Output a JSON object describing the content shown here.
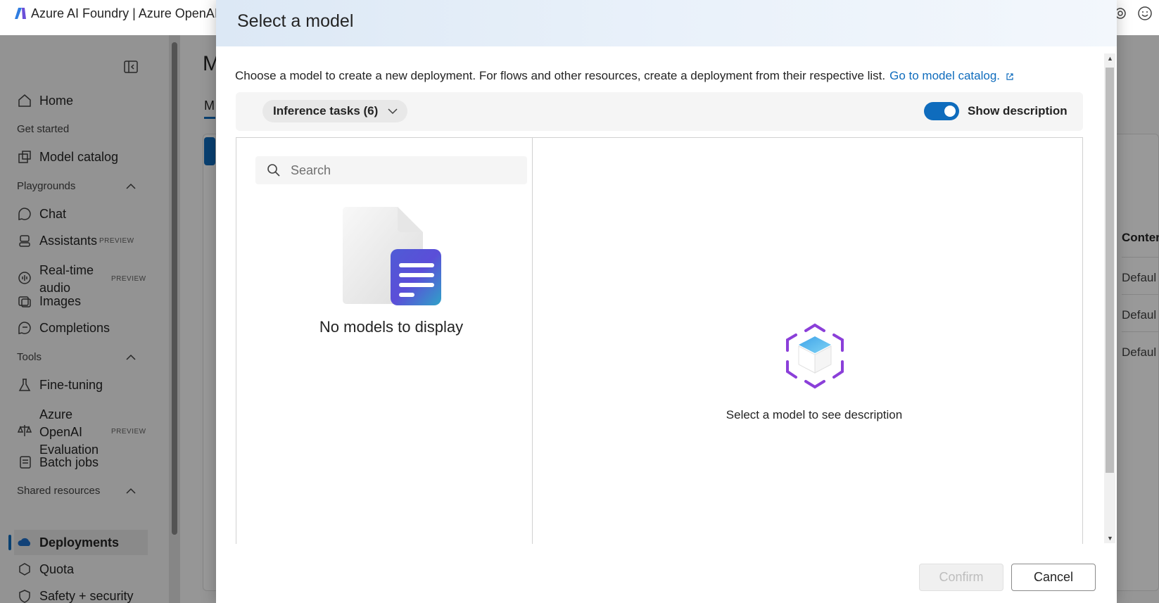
{
  "app": {
    "title": "Azure AI Foundry | Azure OpenAI"
  },
  "sidebar": {
    "home": "Home",
    "get_started": "Get started",
    "model_catalog": "Model catalog",
    "playgrounds": "Playgrounds",
    "chat": "Chat",
    "assistants": "Assistants",
    "realtime_audio_1": "Real-time",
    "realtime_audio_2": "audio",
    "images": "Images",
    "completions": "Completions",
    "tools": "Tools",
    "fine_tuning": "Fine-tuning",
    "evaluation_1": "Azure",
    "evaluation_2": "OpenAI",
    "evaluation_3": "Evaluation",
    "batch_jobs": "Batch jobs",
    "shared_resources": "Shared resources",
    "deployments": "Deployments",
    "quota": "Quota",
    "safety": "Safety + security",
    "preview_badge": "PREVIEW"
  },
  "background": {
    "heading": "M",
    "tab": "M",
    "column_header": "Conter",
    "cells": [
      "Defaul",
      "Defaul",
      "Defaul"
    ]
  },
  "dialog": {
    "title": "Select a model",
    "intro": "Choose a model to create a new deployment. For flows and other resources, create a deployment from their respective list.",
    "catalog_link": "Go to model catalog.",
    "filter_chip": "Inference tasks (6)",
    "toggle_label": "Show description",
    "toggle_on": true,
    "search_placeholder": "Search",
    "empty_text": "No models to display",
    "description_placeholder": "Select a model to see description",
    "confirm": "Confirm",
    "cancel": "Cancel"
  },
  "colors": {
    "accent": "#0f6cbd",
    "illustration_purple": "#8b3fd9"
  }
}
